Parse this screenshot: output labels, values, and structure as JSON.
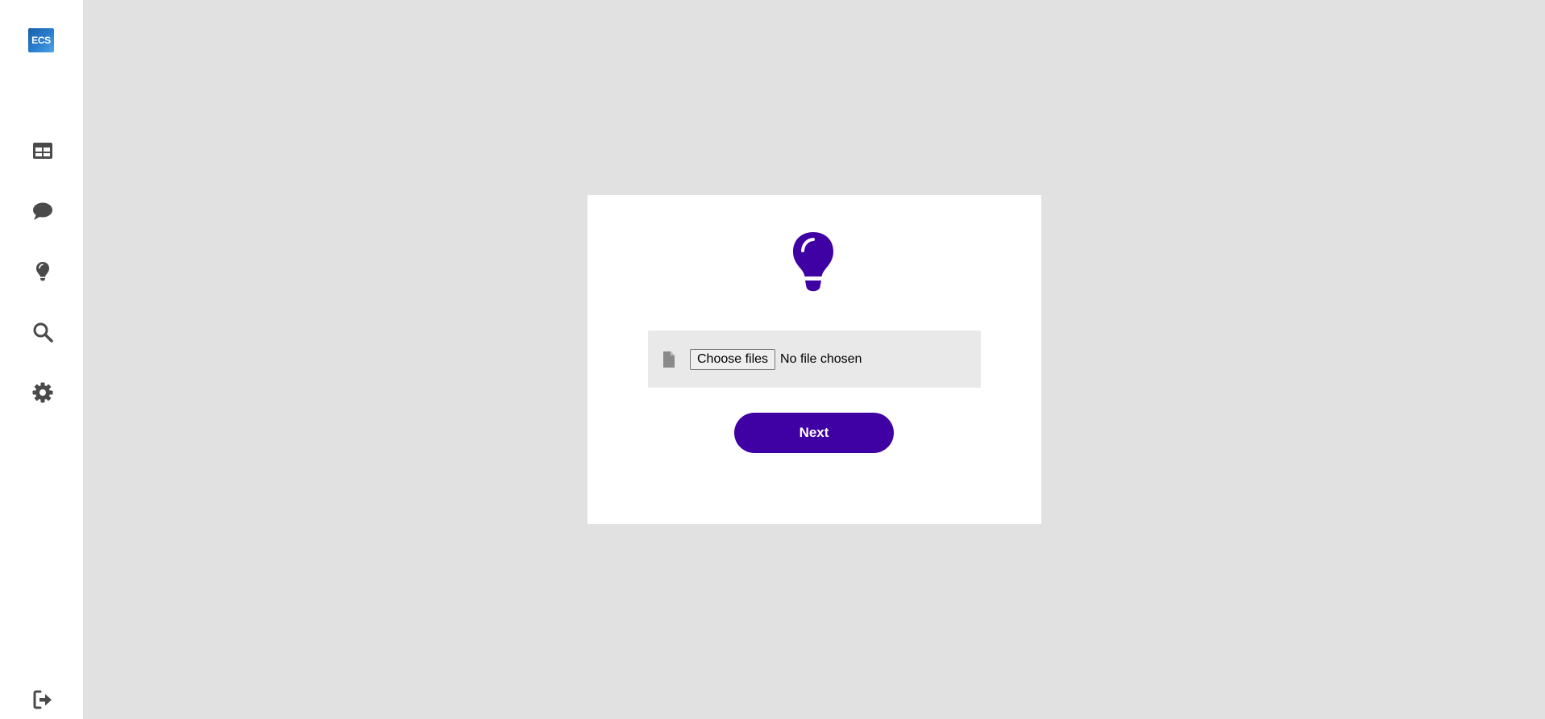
{
  "sidebar": {
    "logo_text": "ECS",
    "items": [
      {
        "icon": "table-icon"
      },
      {
        "icon": "chat-icon"
      },
      {
        "icon": "lightbulb-icon"
      },
      {
        "icon": "search-icon"
      },
      {
        "icon": "gear-icon"
      }
    ],
    "logout_icon": "logout-icon"
  },
  "upload_card": {
    "hero_icon": "lightbulb-icon",
    "file_icon": "file-icon",
    "choose_button_label": "Choose files",
    "file_status": "No file chosen",
    "next_button_label": "Next"
  },
  "colors": {
    "accent": "#3f00a4",
    "background": "#e1e1e1",
    "sidebar_icon": "#4a4a4a",
    "upload_box": "#e9e9e9"
  }
}
